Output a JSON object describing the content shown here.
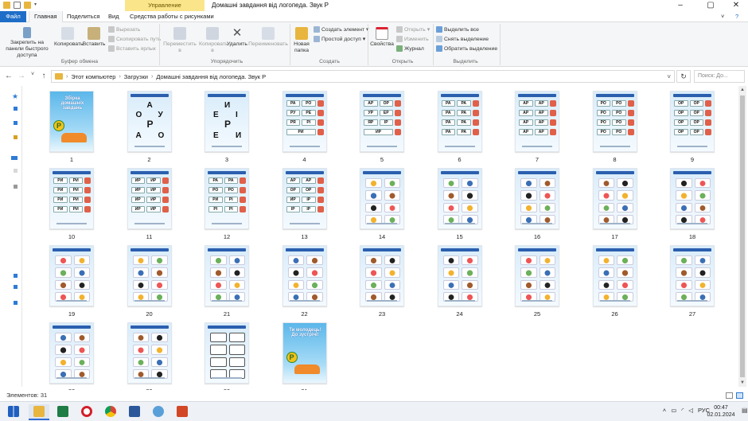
{
  "window": {
    "title": "Домашні завдання від логопеда. Звук Р",
    "context_tab": "Управление",
    "minimize_icon": "minimize-icon",
    "maximize_icon": "restore-icon",
    "close_icon": "close-icon"
  },
  "ribbon_tabs": [
    "Файл",
    "Главная",
    "Поделиться",
    "Вид",
    "Средства работы с рисунками"
  ],
  "ribbon": {
    "clipboard": {
      "pin": "Закрепить на панели быстрого доступа",
      "copy": "Копировать",
      "paste": "Вставить",
      "cut": "Вырезать",
      "copy_path": "Скопировать путь",
      "paste_shortcut": "Вставить ярлык",
      "group": "Буфер обмена"
    },
    "organize": {
      "move_to": "Переместить в",
      "copy_to": "Копировать в",
      "delete": "Удалить",
      "rename": "Переименовать",
      "group": "Упорядочить"
    },
    "create": {
      "new_folder": "Новая папка",
      "new_item": "Создать элемент",
      "easy_access": "Простой доступ",
      "group": "Создать"
    },
    "open": {
      "properties": "Свойства",
      "open": "Открыть",
      "edit": "Изменить",
      "history": "Журнал",
      "group": "Открыть"
    },
    "select": {
      "select_all": "Выделить все",
      "select_none": "Снять выделение",
      "invert": "Обратить выделение",
      "group": "Выделить"
    }
  },
  "address_bar": {
    "path": [
      "Этот компьютер",
      "Загрузки",
      "Домашні завдання від логопеда. Звук Р"
    ],
    "search_placeholder": "Поиск: До..."
  },
  "files": [
    {
      "label": "1",
      "kind": "cover",
      "cover_title": "Збірка домашніх завдань",
      "cover_letter": "Р"
    },
    {
      "label": "2",
      "kind": "letters",
      "letters": [
        "А",
        "О",
        "Р",
        "У",
        "А",
        "О"
      ]
    },
    {
      "label": "3",
      "kind": "letters",
      "letters": [
        "И",
        "Е",
        "Р",
        "І",
        "Е",
        "И"
      ]
    },
    {
      "label": "4",
      "kind": "syllables",
      "syll": [
        "РА",
        "РО",
        "РУ",
        "РЕ",
        "РЯ",
        "РІ",
        "РИ"
      ]
    },
    {
      "label": "5",
      "kind": "syllables",
      "syll": [
        "АР",
        "ОР",
        "УР",
        "ЕР",
        "ЯР",
        "ІР",
        "ИР"
      ]
    },
    {
      "label": "6",
      "kind": "rows",
      "syll": [
        "РА",
        "РА",
        "РА",
        "РА",
        "РА",
        "РА",
        "РА",
        "РА"
      ]
    },
    {
      "label": "7",
      "kind": "rows",
      "syll": [
        "АР",
        "АР",
        "АР",
        "АР",
        "АР",
        "АР",
        "АР",
        "АР"
      ]
    },
    {
      "label": "8",
      "kind": "rows",
      "syll": [
        "РО",
        "РО",
        "РО",
        "РО",
        "РО",
        "РО",
        "РО",
        "РО"
      ]
    },
    {
      "label": "9",
      "kind": "rows",
      "syll": [
        "ОР",
        "ОР",
        "ОР",
        "ОР",
        "ОР",
        "ОР",
        "ОР",
        "ОР"
      ]
    },
    {
      "label": "10",
      "kind": "rows",
      "syll": [
        "РИ",
        "РИ",
        "РИ",
        "РИ",
        "РИ",
        "РИ",
        "РИ",
        "РИ"
      ]
    },
    {
      "label": "11",
      "kind": "rows",
      "syll": [
        "ИР",
        "ИР",
        "ИР",
        "ИР",
        "ИР",
        "ИР",
        "ИР",
        "ИР"
      ]
    },
    {
      "label": "12",
      "kind": "rows",
      "syll": [
        "РА",
        "РА",
        "РО",
        "РО",
        "РИ",
        "РІ",
        "РІ",
        "РІ"
      ]
    },
    {
      "label": "13",
      "kind": "rows",
      "syll": [
        "АР",
        "АР",
        "ОР",
        "ОР",
        "ИР",
        "ІР",
        "ІР",
        "ІР"
      ]
    },
    {
      "label": "14",
      "kind": "pictures"
    },
    {
      "label": "15",
      "kind": "pictures"
    },
    {
      "label": "16",
      "kind": "pictures"
    },
    {
      "label": "17",
      "kind": "pictures"
    },
    {
      "label": "18",
      "kind": "pictures"
    },
    {
      "label": "19",
      "kind": "pictures"
    },
    {
      "label": "20",
      "kind": "pictures"
    },
    {
      "label": "21",
      "kind": "pictures"
    },
    {
      "label": "22",
      "kind": "pictures"
    },
    {
      "label": "23",
      "kind": "pictures"
    },
    {
      "label": "24",
      "kind": "pictures"
    },
    {
      "label": "25",
      "kind": "pictures"
    },
    {
      "label": "26",
      "kind": "pictures"
    },
    {
      "label": "27",
      "kind": "pictures"
    },
    {
      "label": "28",
      "kind": "pictures"
    },
    {
      "label": "29",
      "kind": "pictures"
    },
    {
      "label": "30",
      "kind": "outline"
    },
    {
      "label": "31",
      "kind": "cover",
      "cover_title": "Ти молодець! До зустрічі!",
      "cover_letter": "Р"
    }
  ],
  "status": {
    "count": "Элементов: 31"
  },
  "taskbar": {
    "apps": [
      "windows-start-icon",
      "search-icon",
      "file-explorer-icon",
      "excel-icon",
      "opera-icon",
      "chrome-icon",
      "word-icon",
      "photos-icon",
      "powerpoint-icon"
    ],
    "lang": "РУС",
    "time": "00:47",
    "date": "02.01.2024"
  }
}
